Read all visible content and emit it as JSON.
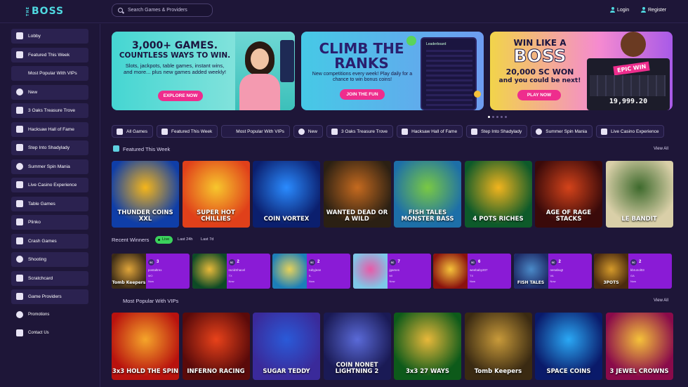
{
  "brand": {
    "logo_small": "THE",
    "logo_big": "BOSS"
  },
  "search": {
    "placeholder": "Search Games & Providers"
  },
  "auth": {
    "login": "Login",
    "register": "Register"
  },
  "sidebar": {
    "items": [
      {
        "label": "Lobby",
        "icon": "lobby-icon"
      },
      {
        "label": "Featured This Week",
        "icon": "featured-icon"
      },
      {
        "label": "Most Popular With VIPs",
        "icon": "vip-icon"
      },
      {
        "label": "New",
        "icon": "new-icon"
      },
      {
        "label": "3 Oaks Treasure Trove",
        "icon": "treasure-icon"
      },
      {
        "label": "Hacksaw Hall of Fame",
        "icon": "hacksaw-icon"
      },
      {
        "label": "Step Into Shadylady",
        "icon": "shadylady-icon"
      },
      {
        "label": "Summer Spin Mania",
        "icon": "sun-icon"
      },
      {
        "label": "Live Casino Experience",
        "icon": "live-casino-icon"
      },
      {
        "label": "Table Games",
        "icon": "table-games-icon"
      },
      {
        "label": "Plinko",
        "icon": "plinko-icon"
      },
      {
        "label": "Crash Games",
        "icon": "crash-icon"
      },
      {
        "label": "Shooting",
        "icon": "shooting-icon"
      },
      {
        "label": "Scratchcard",
        "icon": "scratchcard-icon"
      },
      {
        "label": "Game Providers",
        "icon": "providers-icon"
      }
    ],
    "footer": [
      {
        "label": "Promotions",
        "icon": "promotions-icon"
      },
      {
        "label": "Contact Us",
        "icon": "contact-icon"
      }
    ]
  },
  "banners": [
    {
      "title1": "3,000+ GAMES.",
      "title2": "COUNTLESS WAYS TO WIN.",
      "body": "Slots, jackpots, table games, instant wins, and more... plus new games added weekly!",
      "cta": "EXPLORE NOW"
    },
    {
      "title1": "CLIMB THE",
      "title2": "RANKS",
      "body": "New competitions every week! Play daily for a chance to win bonus coins!",
      "cta": "JOIN THE FUN",
      "board": "Leaderboard"
    },
    {
      "title1": "WIN LIKE A",
      "title2": "BOSS",
      "title3": "20,000 SC WON",
      "body": "and you could be next!",
      "cta": "PLAY NOW",
      "sticker": "EPIC WIN",
      "amount": "19,999.20"
    }
  ],
  "chips": [
    "All Games",
    "Featured This Week",
    "Most Popular With VIPs",
    "New",
    "3 Oaks Treasure Trove",
    "Hacksaw Hall of Fame",
    "Step Into Shadylady",
    "Summer Spin Mania",
    "Live Casino Experience"
  ],
  "featured": {
    "title": "Featured This Week",
    "view_all": "View All",
    "games": [
      {
        "name": "THUNDER COINS XXL",
        "colors": [
          "#0f3ea8",
          "#f5b61a"
        ]
      },
      {
        "name": "SUPER HOT CHILLIES",
        "colors": [
          "#e0401a",
          "#f7c72d"
        ]
      },
      {
        "name": "COIN VORTEX",
        "colors": [
          "#0b1f6e",
          "#2a8bff"
        ]
      },
      {
        "name": "WANTED DEAD OR A WILD",
        "colors": [
          "#2b2013",
          "#c56a1f"
        ]
      },
      {
        "name": "FISH TALES MONSTER BASS",
        "colors": [
          "#1d6fa8",
          "#7ac943"
        ]
      },
      {
        "name": "4 POTS RICHES",
        "colors": [
          "#0d5a2a",
          "#f2b41e"
        ]
      },
      {
        "name": "AGE OF RAGE STACKS",
        "colors": [
          "#3a0a0a",
          "#d4431a"
        ]
      },
      {
        "name": "LE BANDIT",
        "colors": [
          "#d9cfa8",
          "#3e6a2d"
        ]
      }
    ]
  },
  "winners": {
    "title": "Recent Winners",
    "filters": [
      "Live",
      "Last 24h",
      "Last 7d"
    ],
    "items": [
      {
        "amount": "3",
        "user": "postaltrex",
        "state": "MO",
        "time": "Now",
        "colors": [
          "#3a2a16",
          "#e0a53a"
        ]
      },
      {
        "amount": "2",
        "user": "razidShacel",
        "state": "TX",
        "time": "Now",
        "colors": [
          "#0d4a26",
          "#e8b93a"
        ]
      },
      {
        "amount": "2",
        "user": "rubyjean",
        "state": "IL",
        "time": "Now",
        "colors": [
          "#1c7fb8",
          "#e6d25a"
        ]
      },
      {
        "amount": "7",
        "user": "jgames",
        "state": "MI",
        "time": "Now",
        "colors": [
          "#7ec8e8",
          "#e85aa8"
        ]
      },
      {
        "amount": "6",
        "user": "weebaby207",
        "state": "TX",
        "time": "Now",
        "colors": [
          "#8a120e",
          "#f5c23a"
        ]
      },
      {
        "amount": "2",
        "user": "nenabug!",
        "state": "VA",
        "time": "Now",
        "colors": [
          "#1e2a66",
          "#4a8ac8"
        ]
      },
      {
        "amount": "2",
        "user": "kbrunol03",
        "state": "GA",
        "time": "Now",
        "colors": [
          "#4a2a10",
          "#d49a2a"
        ]
      }
    ],
    "thumbs": [
      "Tomb Keepers",
      "",
      "",
      "",
      "",
      "FISH TALES",
      "3POTS"
    ]
  },
  "vip": {
    "title": "Most Popular With VIPs",
    "view_all": "View All",
    "games": [
      {
        "name": "3x3 HOLD THE SPIN",
        "colors": [
          "#b8120e",
          "#f5a52a"
        ]
      },
      {
        "name": "INFERNO RACING",
        "colors": [
          "#5a0a0a",
          "#e8421a"
        ]
      },
      {
        "name": "SUGAR TEDDY",
        "colors": [
          "#3a2a9a",
          "#2a5ad8"
        ]
      },
      {
        "name": "COIN NONET LIGHTNING 2",
        "colors": [
          "#1a1a55",
          "#5a6ad8"
        ]
      },
      {
        "name": "3x3 27 WAYS",
        "colors": [
          "#0d5a1a",
          "#e8b83a"
        ]
      },
      {
        "name": "Tomb Keepers",
        "colors": [
          "#3a2a12",
          "#c89a3a"
        ]
      },
      {
        "name": "SPACE COINS",
        "colors": [
          "#0a1a6a",
          "#2aa8f5"
        ]
      },
      {
        "name": "3 JEWEL CROWNS",
        "colors": [
          "#8a0a4a",
          "#f5c23a"
        ]
      }
    ]
  },
  "colors": {
    "accent": "#ee2d8d",
    "cyan": "#4fd8e0",
    "live": "#3bd15c",
    "purple": "#8a1bd6",
    "bg": "#1e1638"
  }
}
